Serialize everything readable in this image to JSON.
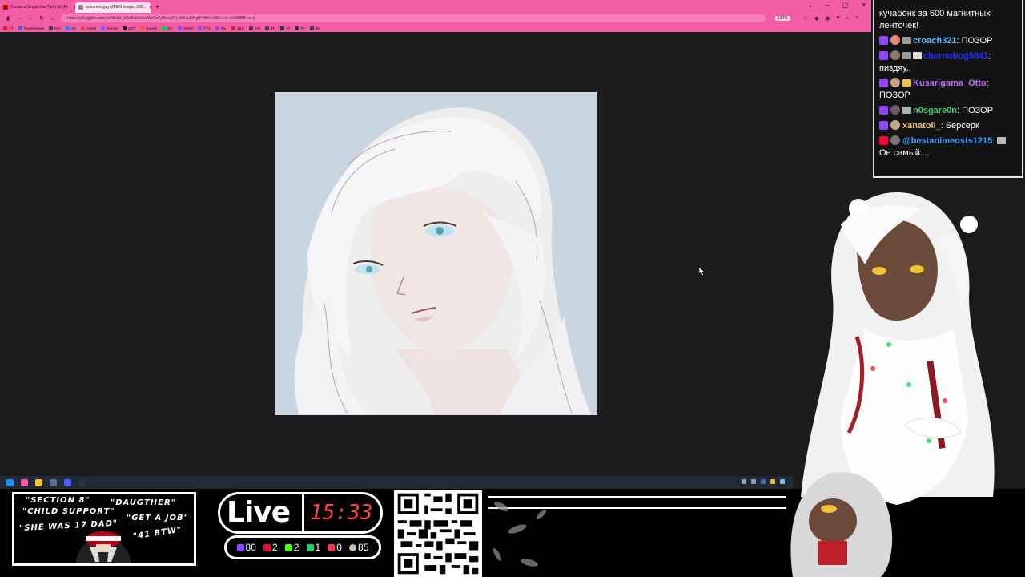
{
  "browser": {
    "tabs": [
      {
        "label": "Create a Single Use Tier List (Fr..."
      },
      {
        "label": "unnamed.jpg (JPEG Image, 300..."
      }
    ],
    "new_tab": "+",
    "url": "https://yt3.ggpht.com/ytc/AIdro_k0s8hdv9oLaWxRn4yBeeq77yWdrAd0HgIPoNA=s900-c-k-c0x00ffffff-no-rj",
    "zoom": "134%",
    "bookmarks": [
      "YT",
      "Переводчик",
      "PoA",
      "VK",
      "GMail",
      "Gemini",
      "GPT",
      "Boosty",
      "DA",
      "Twitch",
      "TTV",
      "IVL",
      "YES",
      "KOI",
      "TR",
      "IG",
      "TF",
      "NS"
    ]
  },
  "overlay": {
    "meme_lines": [
      "\"SECTION 8\"",
      "\"DAUGTHER\"",
      "\"CHILD SUPPORT\"",
      "\"GET A JOB\"",
      "\"SHE WAS 17 DAD\"",
      "\"41 BTW\""
    ],
    "live_label": "Live",
    "live_time": "15:33",
    "stats": [
      {
        "icon": "twitch-icon",
        "value": "80",
        "color": "#9146ff"
      },
      {
        "icon": "youtube-icon",
        "value": "2",
        "color": "#ff0033"
      },
      {
        "icon": "kick-icon",
        "value": "2",
        "color": "#53fc18"
      },
      {
        "icon": "trovo-icon",
        "value": "1",
        "color": "#19d66b"
      },
      {
        "icon": "vk-live-icon",
        "value": "0",
        "color": "#ff3347"
      },
      {
        "icon": "goodgame-icon",
        "value": "85",
        "color": "#c0c0c0"
      }
    ]
  },
  "chat": {
    "messages": [
      {
        "user": "",
        "color": "#ffffff",
        "text": "кучабонк за 600 магнитных ленточек!",
        "badge": "",
        "avatar": false
      },
      {
        "user": "croach321",
        "color": "#5fb9ff",
        "text": "ПОЗОР",
        "badge": "#9146ff",
        "avatar": true
      },
      {
        "user": "chernobog5841",
        "color": "#2233ff",
        "text": "пиздяу..",
        "badge": "#9146ff",
        "avatar": true
      },
      {
        "user": "Kusarigama_Otto",
        "color": "#c070ff",
        "text": "ПОЗОР",
        "badge": "#9146ff",
        "avatar": true
      },
      {
        "user": "n0sgare0n",
        "color": "#42c96b",
        "text": "ПОЗОР",
        "badge": "#9146ff",
        "avatar": true
      },
      {
        "user": "xanatoli_",
        "color": "#e8c26b",
        "text": "Берсерк",
        "badge": "#9146ff",
        "avatar": true
      },
      {
        "user": "@bestanimeosts1215",
        "color": "#3aa0ff",
        "text": "Он самый.....",
        "badge": "#ff0033",
        "avatar": true
      }
    ]
  },
  "viewer": {
    "image_name": "unnamed.jpg"
  }
}
